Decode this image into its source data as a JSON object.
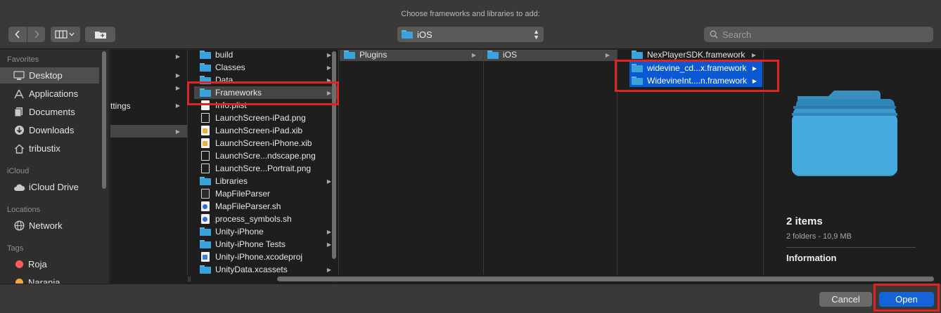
{
  "dialog": {
    "title": "Choose frameworks and libraries to add:"
  },
  "toolbar": {
    "back_icon": "chevron-left-icon",
    "forward_icon": "chevron-right-icon",
    "view_icon": "column-view-icon",
    "new_folder_icon": "new-folder-icon",
    "location": "iOS",
    "search_placeholder": "Search"
  },
  "sidebar": {
    "favorites_label": "Favorites",
    "favorites": [
      {
        "label": "Desktop",
        "icon": "desktop-icon",
        "selected": true
      },
      {
        "label": "Applications",
        "icon": "applications-icon"
      },
      {
        "label": "Documents",
        "icon": "documents-icon"
      },
      {
        "label": "Downloads",
        "icon": "downloads-icon"
      },
      {
        "label": "tribustix",
        "icon": "home-icon"
      }
    ],
    "icloud_label": "iCloud",
    "icloud": [
      {
        "label": "iCloud Drive",
        "icon": "cloud-icon"
      }
    ],
    "locations_label": "Locations",
    "locations": [
      {
        "label": "Network",
        "icon": "network-icon"
      }
    ],
    "tags_label": "Tags",
    "tags": [
      {
        "label": "Roja",
        "color": "#ff5b5b"
      },
      {
        "label": "Naranja",
        "color": "#f7a441"
      }
    ]
  },
  "columns": {
    "col1_partial": "ttings",
    "col2": [
      {
        "name": "build",
        "kind": "folder",
        "arrow": true
      },
      {
        "name": "Classes",
        "kind": "folder",
        "arrow": true
      },
      {
        "name": "Data",
        "kind": "folder",
        "arrow": true
      },
      {
        "name": "Frameworks",
        "kind": "folder",
        "arrow": true,
        "highlight": true
      },
      {
        "name": "Info.plist",
        "kind": "file"
      },
      {
        "name": "LaunchScreen-iPad.png",
        "kind": "outline"
      },
      {
        "name": "LaunchScreen-iPad.xib",
        "kind": "xib"
      },
      {
        "name": "LaunchScreen-iPhone.xib",
        "kind": "xib"
      },
      {
        "name": "LaunchScre...ndscape.png",
        "kind": "outline"
      },
      {
        "name": "LaunchScre...Portrait.png",
        "kind": "outline"
      },
      {
        "name": "Libraries",
        "kind": "folder",
        "arrow": true
      },
      {
        "name": "MapFileParser",
        "kind": "exec"
      },
      {
        "name": "MapFileParser.sh",
        "kind": "sh"
      },
      {
        "name": "process_symbols.sh",
        "kind": "sh"
      },
      {
        "name": "Unity-iPhone",
        "kind": "folder",
        "arrow": true
      },
      {
        "name": "Unity-iPhone Tests",
        "kind": "folder",
        "arrow": true
      },
      {
        "name": "Unity-iPhone.xcodeproj",
        "kind": "proj"
      },
      {
        "name": "UnityData.xcassets",
        "kind": "folder",
        "arrow": true
      }
    ],
    "col3": [
      {
        "name": "Plugins",
        "kind": "folder",
        "arrow": true
      }
    ],
    "col4": [
      {
        "name": "iOS",
        "kind": "folder",
        "arrow": true
      }
    ],
    "col5": [
      {
        "name": "NexPlayerSDK.framework",
        "kind": "folder",
        "arrow": true
      },
      {
        "name": "widevine_cd...x.framework",
        "kind": "folder",
        "arrow": true,
        "selected": true
      },
      {
        "name": "WidevineInt....n.framework",
        "kind": "folder",
        "arrow": true,
        "selected": true
      }
    ]
  },
  "preview": {
    "icon": "folder-stack-icon",
    "count": "2 items",
    "details": "2 folders - 10,9 MB",
    "section": "Information"
  },
  "footer": {
    "cancel_label": "Cancel",
    "open_label": "Open"
  },
  "colors": {
    "accent": "#1463d8",
    "selection": "#0a59d3",
    "annotation": "#e02424",
    "folder": "#3aa3dc"
  }
}
